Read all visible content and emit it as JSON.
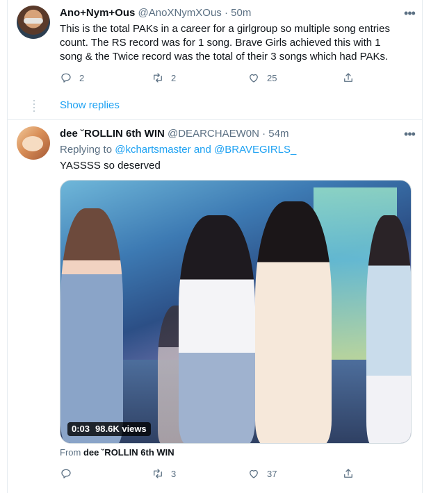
{
  "tweets": [
    {
      "display_name": "Ano+Nym+Ous",
      "handle": "@AnoXNymXOus",
      "separator": "·",
      "time": "50m",
      "text": "This is the total PAKs in a career for a girlgroup so multiple song entries count. The RS record was for 1 song. Brave Girls achieved this with 1 song & the Twice record was the total of their 3 songs which had PAKs.",
      "reply_count": "2",
      "retweet_count": "2",
      "like_count": "25",
      "show_replies": "Show replies"
    },
    {
      "display_name": "dee ˘ROLLIN 6th WIN",
      "handle": "@DEARCHAEW0N",
      "separator": "·",
      "time": "54m",
      "replying_prefix": "Replying to",
      "replying_user1": "@kchartsmaster",
      "replying_and": "and",
      "replying_user2": "@BRAVEGIRLS_",
      "text": "YASSSS so deserved",
      "video_time": "0:03",
      "video_views": "98.6K views",
      "from_label": "From",
      "from_name": "dee ˘ROLLIN 6th WIN",
      "reply_count": "",
      "retweet_count": "3",
      "like_count": "37"
    }
  ],
  "colors": {
    "accent": "#1da1f2",
    "muted": "#5b7083",
    "divider": "#e6ecf0"
  },
  "icons": [
    "more-icon",
    "reply-icon",
    "retweet-icon",
    "like-icon",
    "share-icon"
  ]
}
